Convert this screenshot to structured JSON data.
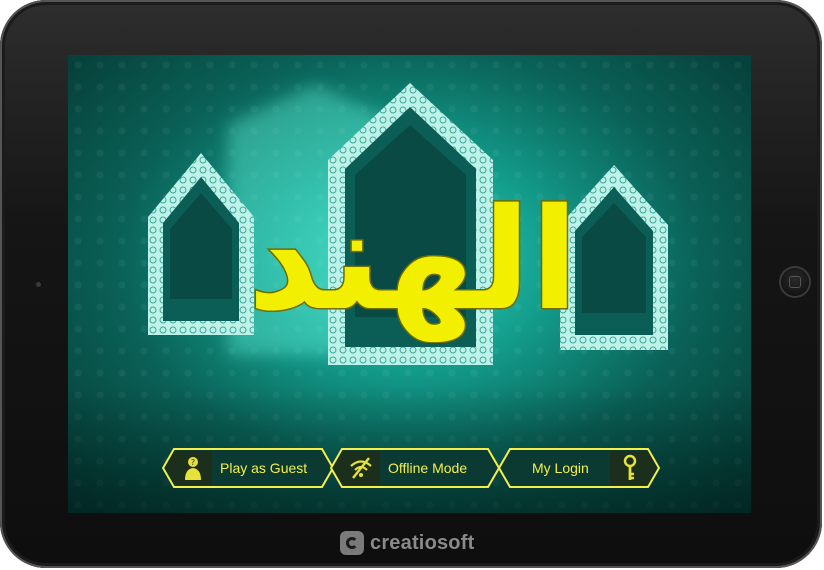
{
  "app": {
    "title": "الهند",
    "brand": "creatiosoft"
  },
  "menu": {
    "buttons": [
      {
        "label": "Play as Guest",
        "icon": "guest-icon"
      },
      {
        "label": "Offline Mode",
        "icon": "no-wifi-icon"
      },
      {
        "label": "My Login",
        "icon": "key-icon"
      }
    ]
  },
  "colors": {
    "accent": "#f2f000",
    "button_border": "#f4ef4a",
    "screen_bg": "#0f8a7a"
  }
}
